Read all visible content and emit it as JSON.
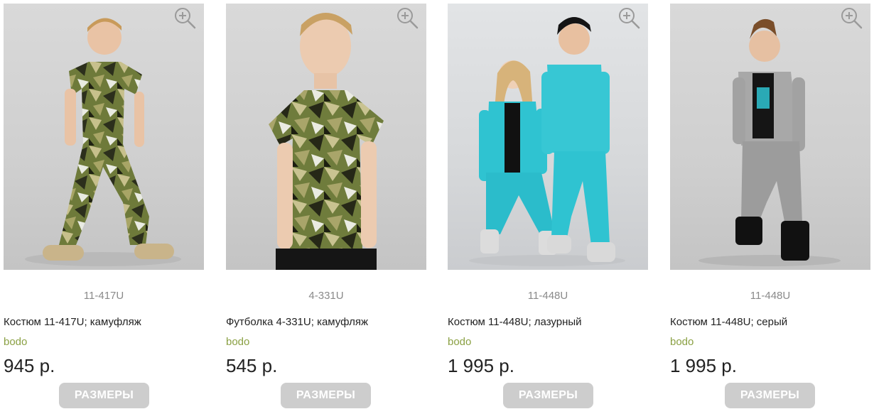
{
  "products": [
    {
      "sku": "11-417U",
      "title": "Костюм 11-417U; камуфляж",
      "brand": "bodo",
      "price": "945 р.",
      "button": "РАЗМЕРЫ",
      "image_alt": "Мальчик в камуфляжном костюме"
    },
    {
      "sku": "4-331U",
      "title": "Футболка 4-331U; камуфляж",
      "brand": "bodo",
      "price": "545 р.",
      "button": "РАЗМЕРЫ",
      "image_alt": "Мальчик в камуфляжной футболке"
    },
    {
      "sku": "11-448U",
      "title": "Костюм 11-448U; лазурный",
      "brand": "bodo",
      "price": "1 995 р.",
      "button": "РАЗМЕРЫ",
      "image_alt": "Дети в лазурных костюмах"
    },
    {
      "sku": "11-448U",
      "title": "Костюм 11-448U; серый",
      "brand": "bodo",
      "price": "1 995 р.",
      "button": "РАЗМЕРЫ",
      "image_alt": "Мальчик в сером костюме"
    }
  ],
  "icons": {
    "zoom": "zoom-in-icon"
  },
  "colors": {
    "brand_link": "#8aa043",
    "button_bg": "#cdcdcd",
    "button_text": "#ffffff",
    "sku_text": "#8a8a8a",
    "title_text": "#222222"
  }
}
